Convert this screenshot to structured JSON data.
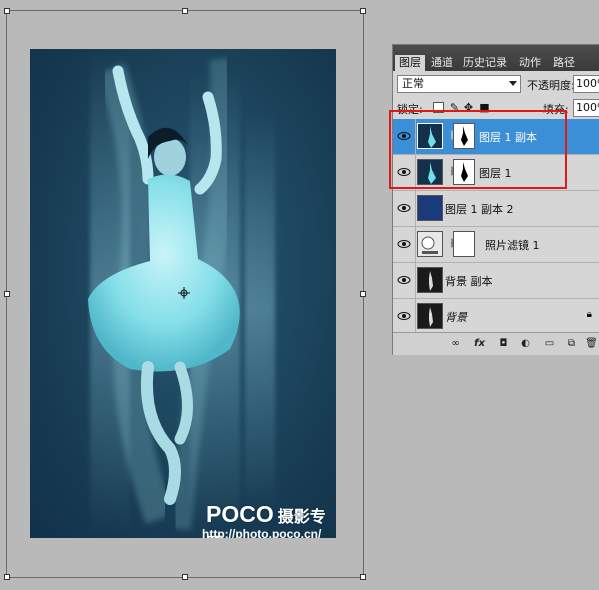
{
  "canvas": {
    "watermark": {
      "brand": "POCO",
      "brand_cn": "摄影专题",
      "url": "http://photo.poco.cn/"
    }
  },
  "layers_panel": {
    "tabs": [
      {
        "label": "图层",
        "active": true
      },
      {
        "label": "通道",
        "active": false
      },
      {
        "label": "历史记录",
        "active": false
      },
      {
        "label": "动作",
        "active": false
      },
      {
        "label": "路径",
        "active": false
      }
    ],
    "blend_mode": "正常",
    "opacity_label": "不透明度:",
    "opacity_value": "100%",
    "lock_label": "锁定:",
    "fill_label": "填充:",
    "fill_value": "100%",
    "layers": [
      {
        "name": "图层 1 副本",
        "selected": true,
        "thumb": "dancer-cyan",
        "has_mask": true
      },
      {
        "name": "图层 1",
        "selected": false,
        "thumb": "dancer-cyan",
        "has_mask": true
      },
      {
        "name": "图层 1 副本 2",
        "selected": false,
        "thumb": "dark-blue",
        "has_mask": false
      },
      {
        "name": "照片滤镜 1",
        "selected": false,
        "thumb": "adjustment",
        "has_mask": true
      },
      {
        "name": "背景 副本",
        "selected": false,
        "thumb": "dancer-dark",
        "has_mask": false
      },
      {
        "name": "背景",
        "selected": false,
        "thumb": "dancer-dark",
        "has_mask": false,
        "locked": true
      }
    ],
    "footer_icons": [
      "link-icon",
      "fx-icon",
      "mask-icon",
      "adjustment-icon",
      "folder-icon",
      "new-layer-icon",
      "trash-icon"
    ]
  },
  "colors": {
    "selection": "#3b8fd6",
    "highlight": "#e01818",
    "photo_bg": "#1f4a63"
  }
}
